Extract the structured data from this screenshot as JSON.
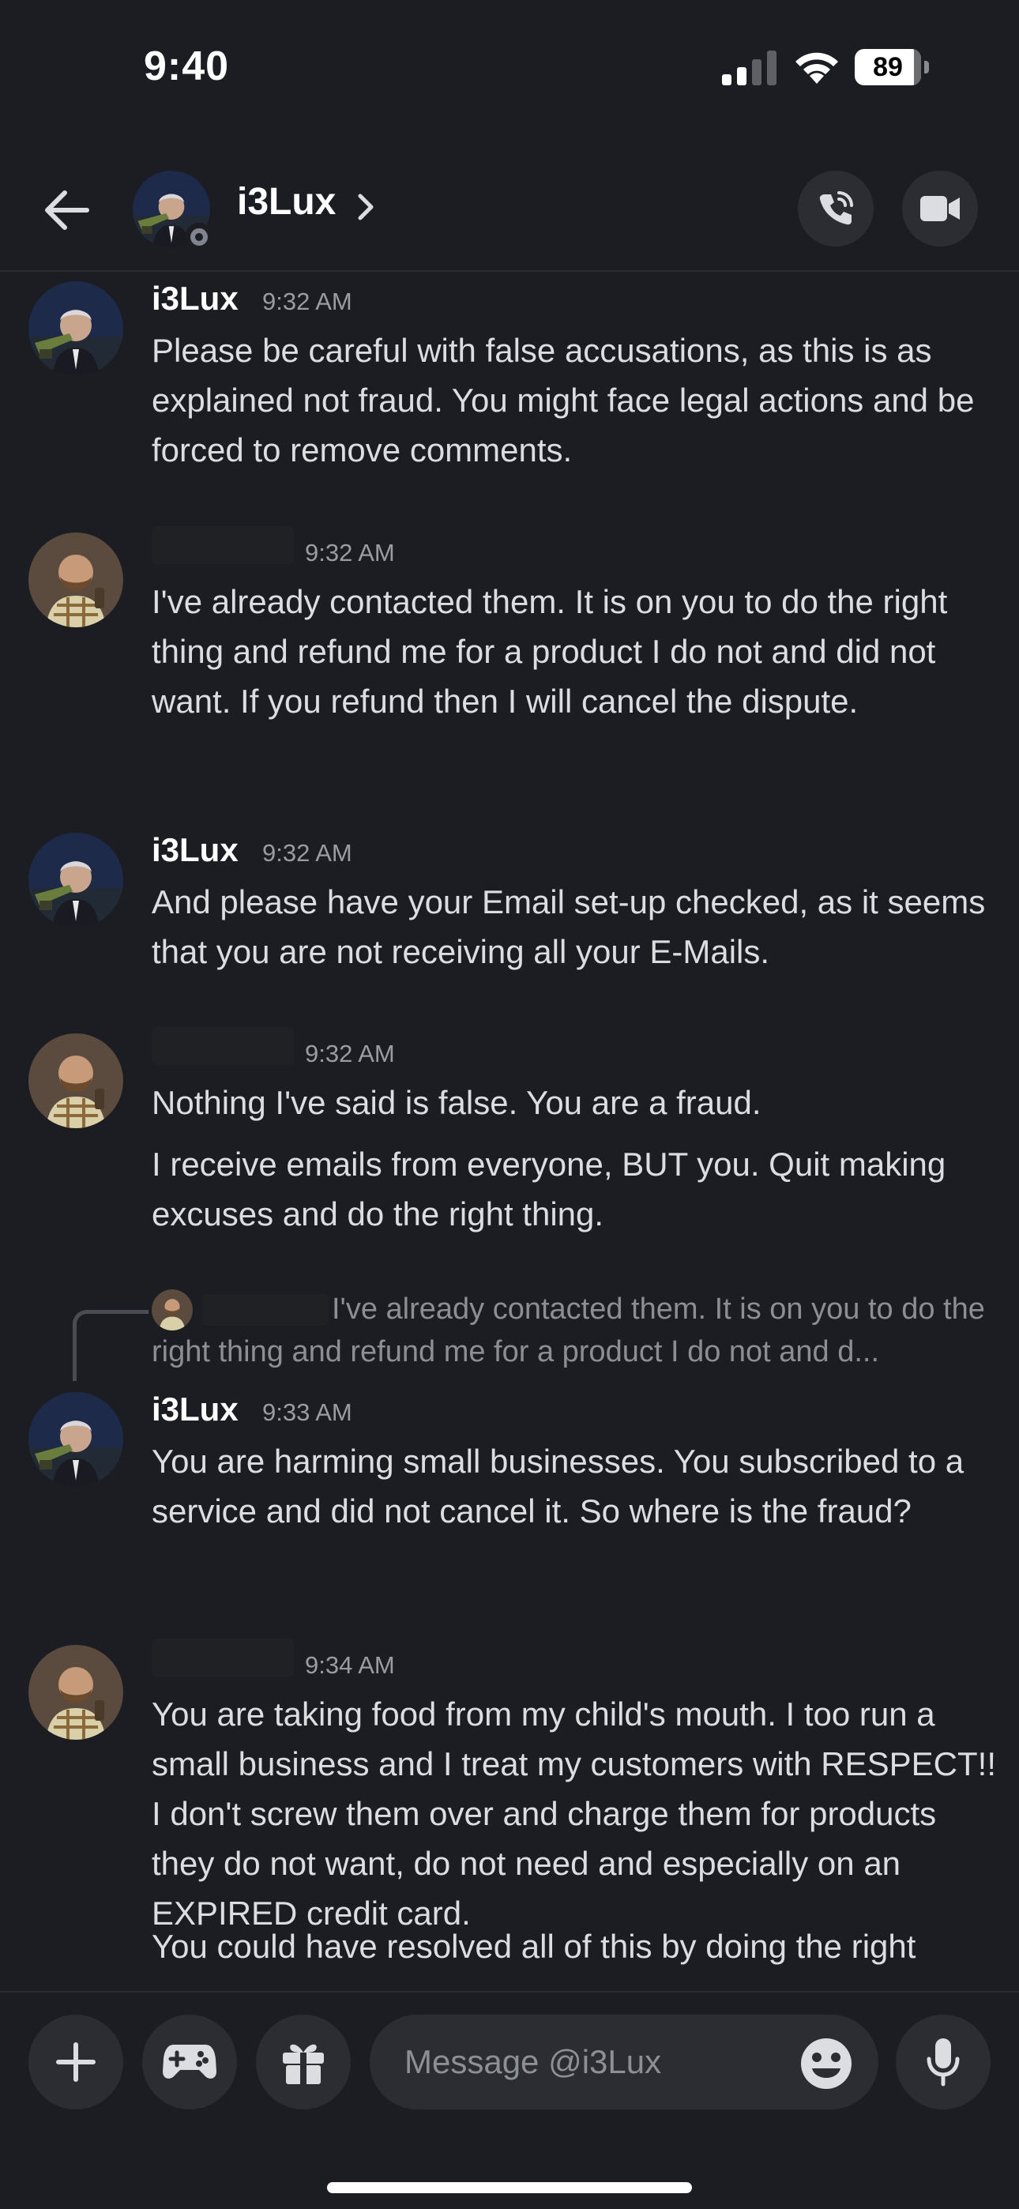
{
  "status_bar": {
    "time": "9:40",
    "battery": "89",
    "battery_level": 0.89
  },
  "header": {
    "title": "i3Lux",
    "status": "offline"
  },
  "messages": [
    {
      "author": "i3Lux",
      "time": "9:32 AM",
      "lines": [
        "Please be careful with false accusations, as this is as explained not fraud. You might face legal actions and be forced to remove comments."
      ]
    },
    {
      "author": "",
      "time": "9:32 AM",
      "lines": [
        "I've already contacted them. It is on you to do the right thing and refund me for a product I do not and did not want. If you refund then I will cancel the dispute."
      ]
    },
    {
      "author": "i3Lux",
      "time": "9:32 AM",
      "lines": [
        "And please have your Email set-up checked, as it seems that you are not receiving all your E-Mails."
      ]
    },
    {
      "author": "",
      "time": "9:32 AM",
      "lines": [
        "Nothing I've said is false. You are a fraud.",
        "I receive emails from everyone, BUT you. Quit making excuses and do the right thing."
      ]
    },
    {
      "reply_to": "I've already contacted them. It is on you to do the right thing and refund me for a product I do not and d...",
      "author": "i3Lux",
      "time": "9:33 AM",
      "lines": [
        "You are harming small businesses. You subscribed to a service and did not cancel it. So where is the fraud?"
      ]
    },
    {
      "author": "",
      "time": "9:34 AM",
      "lines": [
        "You are taking food from my child's mouth. I too run a small business and I treat my customers with RESPECT!! I don't screw them over and charge them for products they do not want, do not need and especially on an EXPIRED credit card.",
        "You could have resolved all of this by doing the right"
      ]
    }
  ],
  "composer": {
    "placeholder": "Message @i3Lux"
  },
  "icons": {
    "back": "arrow-left-icon",
    "call": "phone-call-icon",
    "video": "video-camera-icon",
    "add": "plus-icon",
    "games": "gamepad-icon",
    "gift": "gift-icon",
    "emoji": "emoji-icon",
    "mic": "microphone-icon"
  },
  "colors": {
    "background": "#1c1d22",
    "button": "#2b2d33",
    "text": "#dcdde1",
    "muted": "#9a9ca3"
  }
}
